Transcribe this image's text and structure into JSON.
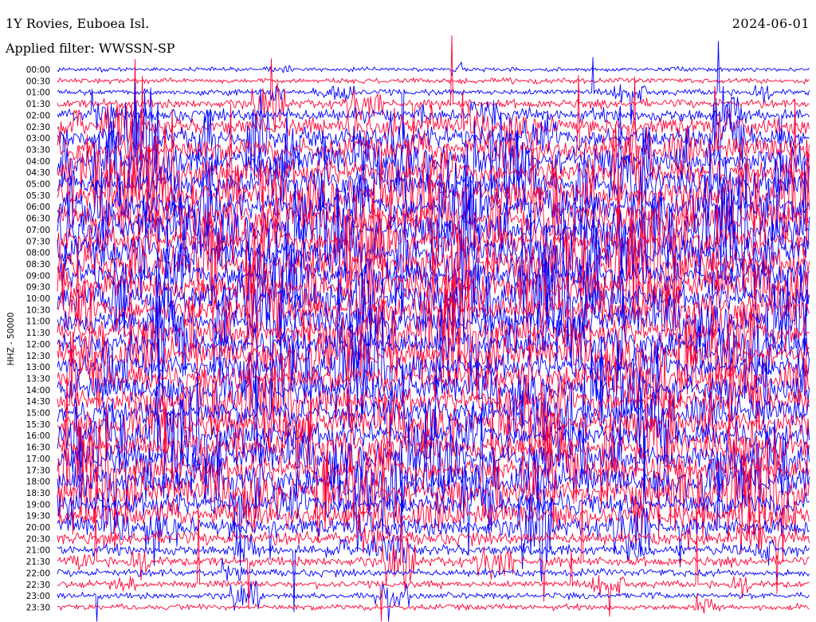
{
  "header": {
    "station": "1Y Rovies, Euboea Isl.",
    "date": "2024-06-01",
    "filter": "Applied filter: WWSSN-SP"
  },
  "chart_data": {
    "type": "helicorder",
    "channel_label": "HHZ - 50000",
    "row_labels": [
      "00:00",
      "00:30",
      "01:00",
      "01:30",
      "02:00",
      "02:30",
      "03:00",
      "03:30",
      "04:00",
      "04:30",
      "05:00",
      "05:30",
      "06:00",
      "06:30",
      "07:00",
      "07:30",
      "08:00",
      "08:30",
      "09:00",
      "09:30",
      "10:00",
      "10:30",
      "11:00",
      "11:30",
      "12:00",
      "12:30",
      "13:00",
      "13:30",
      "14:00",
      "14:30",
      "15:00",
      "15:30",
      "16:00",
      "16:30",
      "17:00",
      "17:30",
      "18:00",
      "18:30",
      "19:00",
      "19:30",
      "20:00",
      "20:30",
      "21:00",
      "21:30",
      "22:00",
      "22:30",
      "23:00",
      "23:30"
    ],
    "row_colors": [
      "#0000ff",
      "#ff0033"
    ],
    "relative_amplitude": [
      0.25,
      0.3,
      0.35,
      0.5,
      0.8,
      1.0,
      1.2,
      1.3,
      1.4,
      1.45,
      1.5,
      1.55,
      1.6,
      1.6,
      1.6,
      1.6,
      1.65,
      1.65,
      1.6,
      1.6,
      1.55,
      1.55,
      1.5,
      1.5,
      1.45,
      1.45,
      1.4,
      1.4,
      1.4,
      1.4,
      1.4,
      1.4,
      1.45,
      1.5,
      1.5,
      1.5,
      1.45,
      1.4,
      1.3,
      1.2,
      1.0,
      0.8,
      0.65,
      0.55,
      0.45,
      0.4,
      0.35,
      0.35
    ],
    "grid": false
  }
}
